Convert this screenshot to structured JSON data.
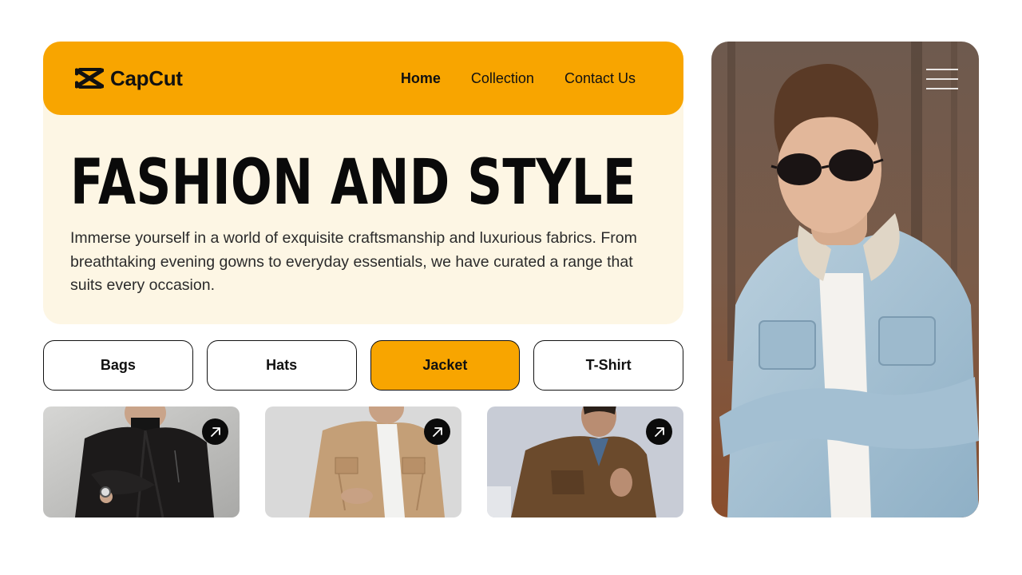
{
  "header": {
    "brand": "CapCut",
    "logo_icon": "capcut-logo-icon",
    "accent_color": "#f8a500",
    "nav": [
      {
        "label": "Home",
        "active": true
      },
      {
        "label": "Collection",
        "active": false
      },
      {
        "label": "Contact Us",
        "active": false
      }
    ]
  },
  "hero": {
    "title": "FASHION AND STYLE",
    "description": "Immerse yourself in a world of exquisite craftsmanship and luxurious fabrics. From breathtaking evening gowns to everyday essentials, we have curated a range that suits every occasion.",
    "background_color": "#fdf6e4"
  },
  "categories": [
    {
      "label": "Bags",
      "active": false
    },
    {
      "label": "Hats",
      "active": false
    },
    {
      "label": "Jacket",
      "active": true
    },
    {
      "label": "T-Shirt",
      "active": false
    }
  ],
  "products": [
    {
      "image": "black leather jacket",
      "icon": "arrow-up-right-icon"
    },
    {
      "image": "beige shirt jacket",
      "icon": "arrow-up-right-icon"
    },
    {
      "image": "brown suede jacket",
      "icon": "arrow-up-right-icon"
    }
  ],
  "feature_photo": {
    "image": "man in denim sherpa jacket with sunglasses",
    "menu_icon": "hamburger-menu-icon"
  }
}
